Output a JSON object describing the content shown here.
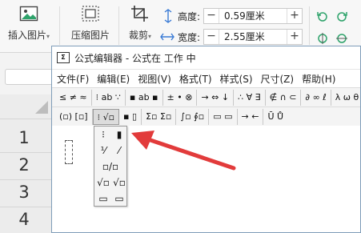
{
  "ribbon": {
    "insert_picture": "插入图片",
    "compress_picture": "压缩图片",
    "crop": "裁剪",
    "height_label": "高度:",
    "height_value": "0.59厘米",
    "width_label": "宽度:",
    "width_value": "2.55厘米",
    "minus": "−",
    "plus": "+",
    "dropdown_caret": "▾"
  },
  "sheet": {
    "row_numbers": [
      "1",
      "2",
      "3",
      "4"
    ]
  },
  "editor": {
    "app_icon": "Σ",
    "title": "公式编辑器 - 公式在 工作 中",
    "menu": [
      "文件(F)",
      "编辑(E)",
      "视图(V)",
      "格式(T)",
      "样式(S)",
      "尺寸(Z)",
      "帮助(H)"
    ],
    "toolbar_row1": [
      "≤ ≠ ≈",
      "⁝ ab ∵",
      "▪ ab ▪",
      "± • ⊗",
      "→ ⇔ ↓",
      "∴ ∀ ∃",
      "∉ ∩ ⊂",
      "∂ ∞ ℓ",
      "λ ω θ"
    ],
    "toolbar_row2": [
      "(▫) [▫]",
      "⁝ √▫",
      "▪ ▯",
      "Σ▫ Σ▫",
      "∫▫ ∮▫",
      "▭ ▭",
      "→ ←",
      "Ū Ů"
    ]
  },
  "palette": {
    "cells": [
      "⁝",
      "▮",
      "⅟",
      "⁄",
      "▫/▫",
      "√▫",
      "√▫",
      "▭",
      "▭"
    ]
  },
  "colors": {
    "arrow": "#e23b3b",
    "editor_border": "#7f9db9"
  }
}
